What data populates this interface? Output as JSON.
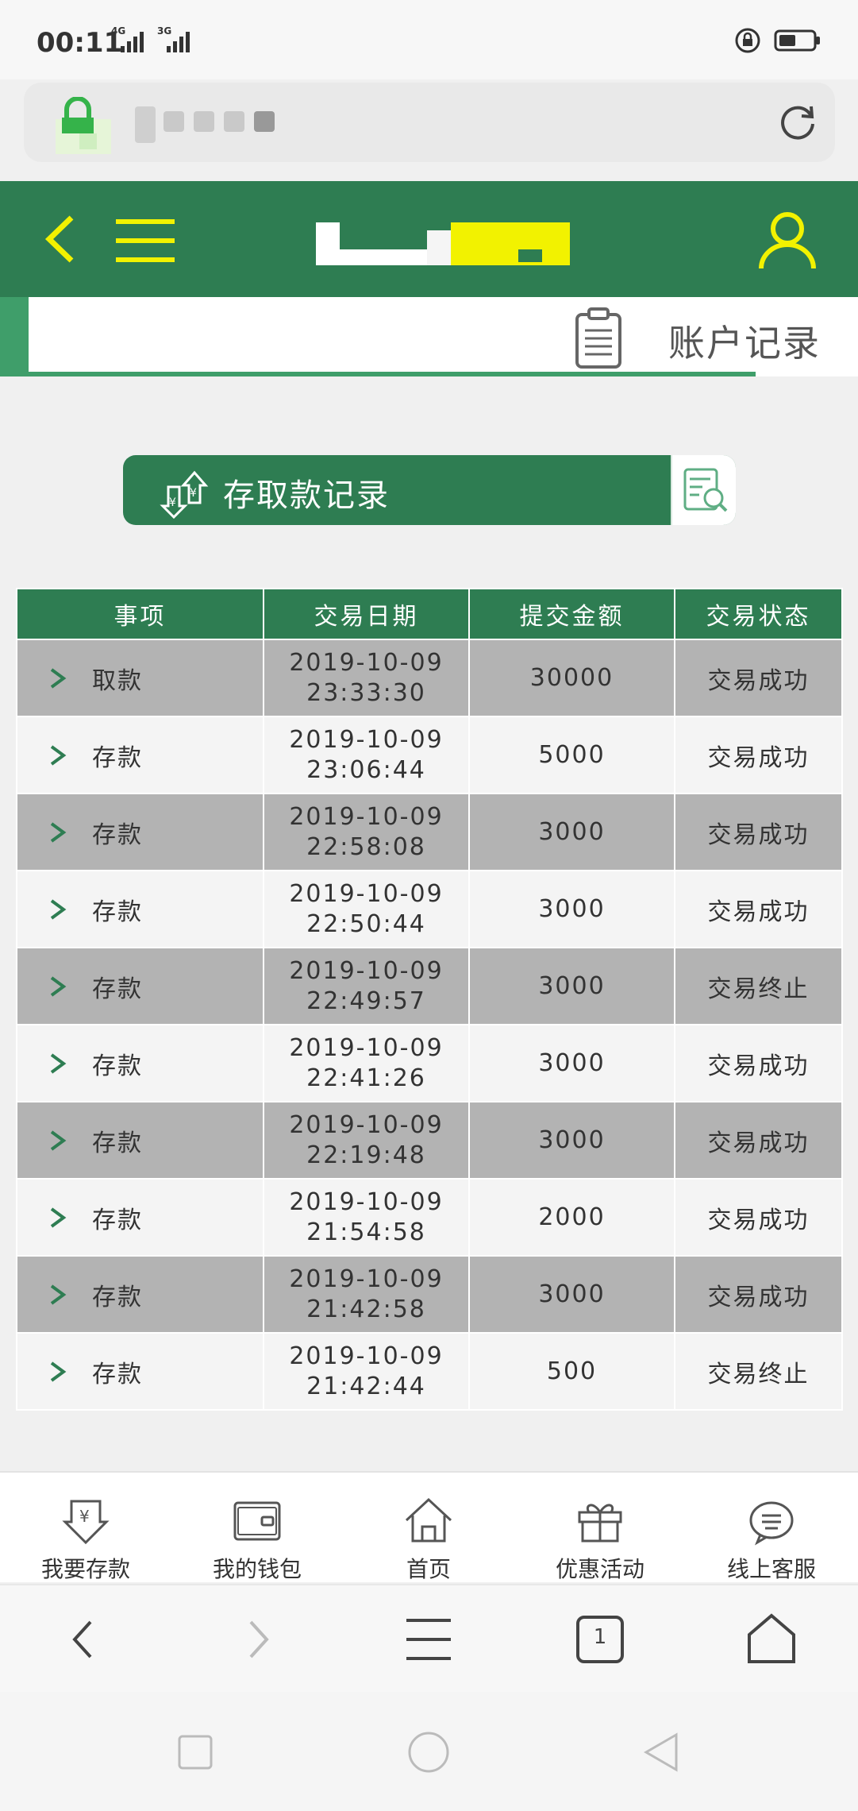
{
  "status_bar": {
    "time": "00:11",
    "signals": [
      {
        "network": "4G",
        "level": 4
      },
      {
        "network": "3G",
        "level": 4
      }
    ]
  },
  "header": {
    "record_title": "账户记录"
  },
  "banner": {
    "label": "存取款记录"
  },
  "table": {
    "headers": [
      "事项",
      "交易日期",
      "提交金额",
      "交易状态"
    ],
    "rows": [
      {
        "item": "取款",
        "date": "2019-10-09",
        "time": "23:33:30",
        "amount": "30000",
        "status": "交易成功",
        "status_type": "ok"
      },
      {
        "item": "存款",
        "date": "2019-10-09",
        "time": "23:06:44",
        "amount": "5000",
        "status": "交易成功",
        "status_type": "ok"
      },
      {
        "item": "存款",
        "date": "2019-10-09",
        "time": "22:58:08",
        "amount": "3000",
        "status": "交易成功",
        "status_type": "ok"
      },
      {
        "item": "存款",
        "date": "2019-10-09",
        "time": "22:50:44",
        "amount": "3000",
        "status": "交易成功",
        "status_type": "ok"
      },
      {
        "item": "存款",
        "date": "2019-10-09",
        "time": "22:49:57",
        "amount": "3000",
        "status": "交易终止",
        "status_type": "stop"
      },
      {
        "item": "存款",
        "date": "2019-10-09",
        "time": "22:41:26",
        "amount": "3000",
        "status": "交易成功",
        "status_type": "ok"
      },
      {
        "item": "存款",
        "date": "2019-10-09",
        "time": "22:19:48",
        "amount": "3000",
        "status": "交易成功",
        "status_type": "ok"
      },
      {
        "item": "存款",
        "date": "2019-10-09",
        "time": "21:54:58",
        "amount": "2000",
        "status": "交易成功",
        "status_type": "ok"
      },
      {
        "item": "存款",
        "date": "2019-10-09",
        "time": "21:42:58",
        "amount": "3000",
        "status": "交易成功",
        "status_type": "ok"
      },
      {
        "item": "存款",
        "date": "2019-10-09",
        "time": "21:42:44",
        "amount": "500",
        "status": "交易终止",
        "status_type": "stop"
      }
    ]
  },
  "bottom_nav": {
    "items": [
      {
        "label": "我要存款",
        "icon": "deposit-icon"
      },
      {
        "label": "我的钱包",
        "icon": "wallet-icon"
      },
      {
        "label": "首页",
        "icon": "home-icon"
      },
      {
        "label": "优惠活动",
        "icon": "gift-icon"
      },
      {
        "label": "线上客服",
        "icon": "chat-icon"
      }
    ]
  },
  "browser": {
    "tab_count": "1"
  },
  "colors": {
    "brand_green": "#2e7d52",
    "accent_yellow": "#f2f200",
    "status_ok": "#2aa07a",
    "status_stop": "#e83a3a"
  }
}
